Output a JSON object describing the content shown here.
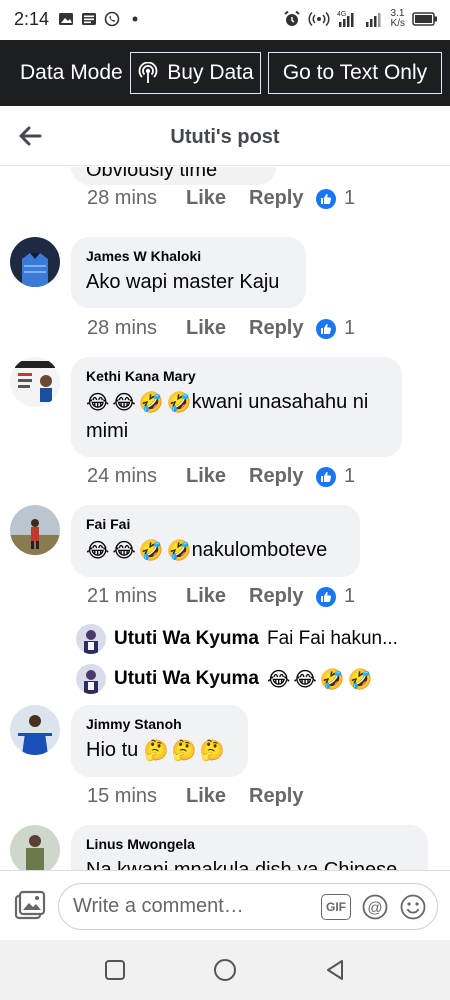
{
  "status_bar": {
    "time": "2:14",
    "network_speed_top": "3.1",
    "network_speed_unit": "K/s",
    "network_type": "4G"
  },
  "data_bar": {
    "mode_label": "Data Mode",
    "buy_data_label": "Buy Data",
    "text_only_label": "Go to Text Only"
  },
  "header": {
    "title": "Ututi's post"
  },
  "comments": [
    {
      "name": "",
      "text": "Obviously time",
      "time": "28 mins",
      "like_label": "Like",
      "reply_label": "Reply",
      "reactions": "1"
    },
    {
      "name": "James W Khaloki",
      "text": "Ako wapi master Kaju",
      "time": "28 mins",
      "like_label": "Like",
      "reply_label": "Reply",
      "reactions": "1"
    },
    {
      "name": "Kethi Kana Mary",
      "text_emojis": [
        "😂",
        "😂",
        "🤣",
        "🤣"
      ],
      "text": "kwani unasahahu ni mimi",
      "time": "24 mins",
      "like_label": "Like",
      "reply_label": "Reply",
      "reactions": "1"
    },
    {
      "name": "Fai Fai",
      "text_emojis": [
        "😂",
        "😂",
        "🤣",
        "🤣"
      ],
      "text": "nakulomboteve",
      "time": "21 mins",
      "like_label": "Like",
      "reply_label": "Reply",
      "reactions": "1",
      "replies": [
        {
          "name": "Ututi Wa Kyuma",
          "text": "Fai Fai hakun..."
        },
        {
          "name": "Ututi Wa Kyuma",
          "text_emojis": [
            "😂",
            "😂",
            "🤣",
            "🤣"
          ]
        }
      ]
    },
    {
      "name": "Jimmy Stanoh",
      "text": "Hio tu",
      "text_emojis_after": [
        "🤔",
        "🤔",
        "🤔"
      ],
      "time": "15 mins",
      "like_label": "Like",
      "reply_label": "Reply"
    },
    {
      "name": "Linus Mwongela",
      "text": "Na kwani mnakula dish ya Chinese"
    }
  ],
  "composer": {
    "placeholder": "Write a comment…",
    "gif_label": "GIF"
  },
  "colors": {
    "accent": "#1877f2",
    "bubble": "#f0f2f5",
    "data_bar": "#1c1e21",
    "meta_text": "#65676b"
  },
  "icons": [
    "back-arrow-icon",
    "broadcast-icon",
    "like-icon",
    "photo-icon",
    "gif-icon",
    "mention-icon",
    "emoji-icon",
    "nav-recents-icon",
    "nav-home-icon",
    "nav-back-icon"
  ]
}
